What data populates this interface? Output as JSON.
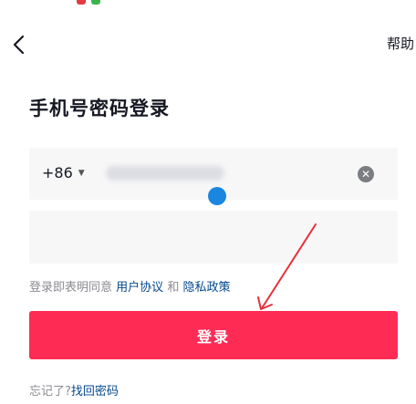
{
  "header": {
    "help_label": "帮助"
  },
  "title": "手机号密码登录",
  "phone": {
    "country_code": "+86",
    "number": ""
  },
  "password": {
    "value": ""
  },
  "agreement": {
    "prefix": "登录即表明同意",
    "user_agreement": "用户协议",
    "and": "和",
    "privacy_policy": "隐私政策"
  },
  "login_button": "登录",
  "forgot": {
    "prefix": "忘记了?",
    "link": "找回密码"
  },
  "colors": {
    "accent": "#fe2c55",
    "link": "#04498d",
    "annotation_arrow": "#e8303a",
    "touch_indicator": "#1b86e0"
  },
  "icons": [
    "back-arrow-icon",
    "clear-icon",
    "dropdown-caret-icon"
  ]
}
